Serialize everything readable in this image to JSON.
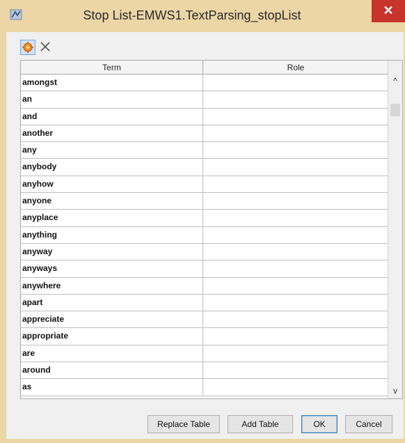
{
  "window": {
    "title": "Stop List-EMWS1.TextParsing_stopList",
    "close_glyph": "✕"
  },
  "toolbar": {
    "add_icon": "add-row-icon",
    "delete_icon": "delete-icon"
  },
  "table": {
    "headers": [
      "Term",
      "Role"
    ],
    "rows": [
      {
        "term": "amongst",
        "role": ""
      },
      {
        "term": "an",
        "role": ""
      },
      {
        "term": "and",
        "role": ""
      },
      {
        "term": "another",
        "role": ""
      },
      {
        "term": "any",
        "role": ""
      },
      {
        "term": "anybody",
        "role": ""
      },
      {
        "term": "anyhow",
        "role": ""
      },
      {
        "term": "anyone",
        "role": ""
      },
      {
        "term": "anyplace",
        "role": ""
      },
      {
        "term": "anything",
        "role": ""
      },
      {
        "term": "anyway",
        "role": ""
      },
      {
        "term": "anyways",
        "role": ""
      },
      {
        "term": "anywhere",
        "role": ""
      },
      {
        "term": "apart",
        "role": ""
      },
      {
        "term": "appreciate",
        "role": ""
      },
      {
        "term": "appropriate",
        "role": ""
      },
      {
        "term": "are",
        "role": ""
      },
      {
        "term": "around",
        "role": ""
      },
      {
        "term": "as",
        "role": ""
      }
    ]
  },
  "scrollbar": {
    "up_glyph": "^",
    "down_glyph": "v"
  },
  "buttons": {
    "replace_table": "Replace Table",
    "add_table": "Add Table",
    "ok": "OK",
    "cancel": "Cancel"
  }
}
